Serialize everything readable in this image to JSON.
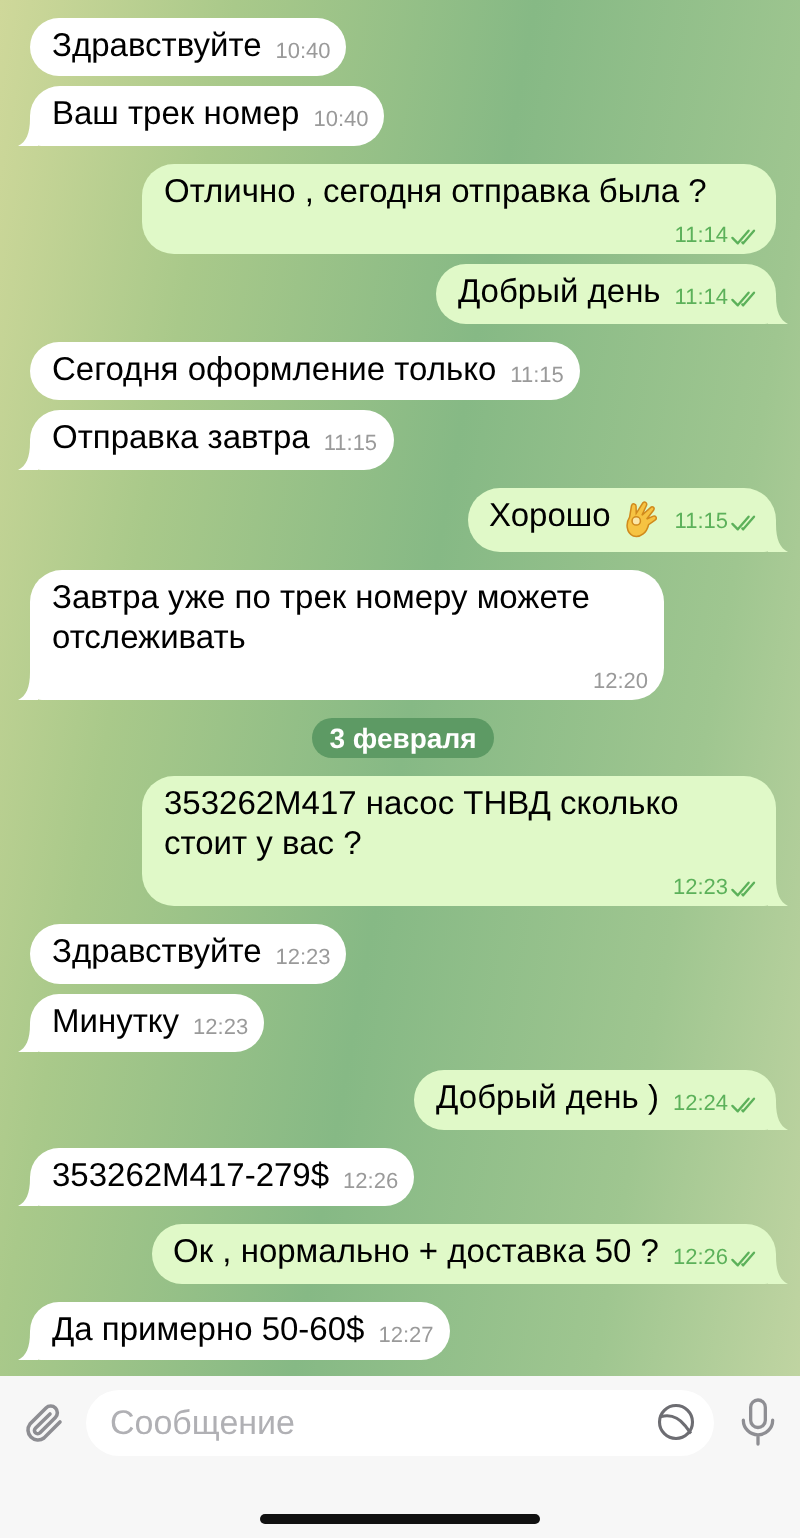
{
  "messages": [
    {
      "kind": "incoming",
      "text": "Здравствуйте",
      "time": "10:40",
      "tail": false
    },
    {
      "kind": "incoming",
      "text": "Ваш трек номер",
      "time": "10:40",
      "tail": true
    },
    {
      "kind": "outgoing",
      "text": "Отлично , сегодня отправка была ?",
      "time": "11:14",
      "read": true,
      "tail": false
    },
    {
      "kind": "outgoing",
      "text": "Добрый день",
      "time": "11:14",
      "read": true,
      "tail": true
    },
    {
      "kind": "incoming",
      "text": "Сегодня оформление только",
      "time": "11:15",
      "tail": false
    },
    {
      "kind": "incoming",
      "text": "Отправка завтра",
      "time": "11:15",
      "tail": true
    },
    {
      "kind": "outgoing",
      "text": "Хорошо",
      "ok_hand_emoji": true,
      "time": "11:15",
      "read": true,
      "tail": true
    },
    {
      "kind": "incoming",
      "text": "Завтра уже по трек номеру можете отслеживать",
      "time": "12:20",
      "tail": true
    },
    {
      "kind": "date",
      "text": "3 февраля"
    },
    {
      "kind": "outgoing",
      "text": "353262M417 насос ТНВД сколько стоит у вас ?",
      "time": "12:23",
      "read": true,
      "tail": true
    },
    {
      "kind": "incoming",
      "text": "Здравствуйте",
      "time": "12:23",
      "tail": false
    },
    {
      "kind": "incoming",
      "text": "Минутку",
      "time": "12:23",
      "tail": true
    },
    {
      "kind": "outgoing",
      "text": "Добрый день )",
      "time": "12:24",
      "read": true,
      "tail": true
    },
    {
      "kind": "incoming",
      "text": "353262M417-279$",
      "time": "12:26",
      "tail": true
    },
    {
      "kind": "outgoing",
      "text": "Ок , нормально + доставка 50 ?",
      "time": "12:26",
      "read": true,
      "tail": true
    },
    {
      "kind": "incoming",
      "text": "Да примерно 50-60$",
      "time": "12:27",
      "tail": true
    }
  ],
  "composer": {
    "placeholder": "Сообщение"
  }
}
